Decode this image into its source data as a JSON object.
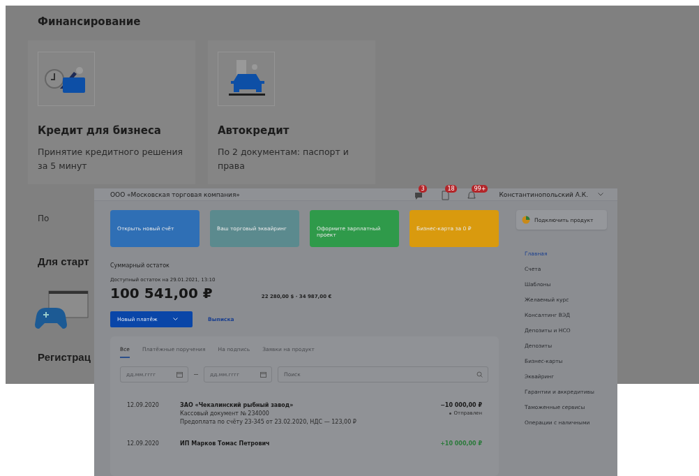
{
  "background_page": {
    "section_title": "Финансирование",
    "cards": [
      {
        "title": "Кредит для бизнеса",
        "description": "Принятие кредитного решения за 5 минут",
        "footer": "По",
        "kind": "credit"
      },
      {
        "title": "Автокредит",
        "description": "По 2 документам: паспорт и права",
        "kind": "car"
      }
    ],
    "section_2_title": "Для старт",
    "section_3_title": "Регистрац"
  },
  "app": {
    "company": "ООО «Московская торговая компания»",
    "notifications": [
      {
        "kind": "chat",
        "count": "3"
      },
      {
        "kind": "document",
        "count": "18"
      },
      {
        "kind": "bell",
        "count": "99+"
      }
    ],
    "user": "Константинопольский А.К.",
    "banners": [
      {
        "text": "Открыть новый счёт",
        "color": "#2f6fb5"
      },
      {
        "text": "Ваш торговый эквайринг",
        "color": "#5b8a8e"
      },
      {
        "text": "Оформите зарплатный проект",
        "color": "#2f9a4a"
      },
      {
        "text": "Бизнес-карта за 0 ₽",
        "color": "#d99a0e"
      }
    ],
    "balance_label": "Суммарный остаток",
    "available_label": "Доступный остаток на 29.01.2021, 13:10",
    "balance": "100 541,00 ₽",
    "other_currencies": "22 280,00 $ · 34 987,00 €",
    "primary_button": "Новый платёж",
    "link": "Выписка",
    "tabs": [
      {
        "label": "Все",
        "selected": true
      },
      {
        "label": "Платёжные поручения",
        "selected": false
      },
      {
        "label": "На подпись",
        "selected": false
      },
      {
        "label": "Заявки на продукт",
        "selected": false
      }
    ],
    "date_from": {
      "placeholder": "дд.мм.гггг"
    },
    "date_to": {
      "placeholder": "дд.мм.гггг"
    },
    "search": {
      "placeholder": "Поиск"
    },
    "transactions": [
      {
        "date": "12.09.2020",
        "counterparty": "ЗАО «Чекалинский рыбный завод»",
        "lines": [
          "Кассовый документ № 234000",
          "Предоплата по счёту 23-345 от 23.02.2020, НДС — 123,00 ₽"
        ],
        "amount": "−10 000,00 ₽",
        "kind": "expense",
        "status": "Отправлен"
      },
      {
        "date": "12.09.2020",
        "counterparty": "ИП Марков Томас Петрович",
        "amount": "+10 000,00 ₽",
        "kind": "income"
      }
    ],
    "connect_button": "Подключить продукт",
    "sidebar": [
      {
        "label": "Главная",
        "selected": true
      },
      {
        "label": "Счета",
        "selected": false
      },
      {
        "label": "Шаблоны",
        "selected": false
      },
      {
        "label": "Желаемый курс",
        "selected": false
      },
      {
        "label": "Консалтинг ВЭД",
        "selected": false
      },
      {
        "label": "Депозиты и НСО",
        "selected": false
      },
      {
        "label": "Депозиты",
        "selected": false
      },
      {
        "label": "Бизнес-карты",
        "selected": false
      },
      {
        "label": "Эквайринг",
        "selected": false
      },
      {
        "label": "Гарантии и аккредитивы",
        "selected": false
      },
      {
        "label": "Таможенные сервисы",
        "selected": false
      },
      {
        "label": "Операции с наличными",
        "selected": false
      }
    ]
  }
}
